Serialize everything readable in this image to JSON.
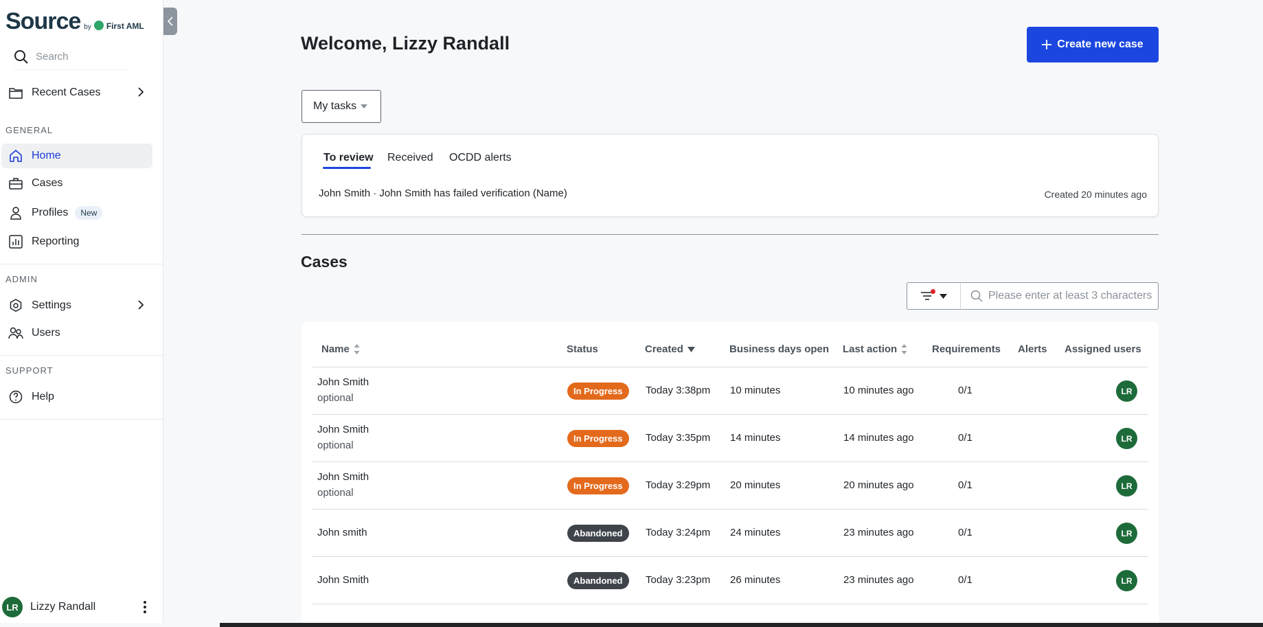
{
  "sidebar": {
    "logo": {
      "main": "Source",
      "by": "by",
      "brand": "First AML"
    },
    "search_placeholder": "Search",
    "recent_cases": "Recent Cases",
    "sections": {
      "general": "GENERAL",
      "admin": "ADMIN",
      "support": "SUPPORT"
    },
    "items": {
      "home": "Home",
      "cases": "Cases",
      "profiles": "Profiles",
      "profiles_badge": "New",
      "reporting": "Reporting",
      "settings": "Settings",
      "users": "Users",
      "help": "Help"
    },
    "user": {
      "initials": "LR",
      "name": "Lizzy Randall"
    }
  },
  "header": {
    "welcome": "Welcome, Lizzy Randall",
    "create_button": "Create new case"
  },
  "tasks": {
    "selector": "My tasks",
    "tabs": [
      "To review",
      "Received",
      "OCDD alerts"
    ],
    "active_tab": "To review",
    "item": {
      "name": "John Smith",
      "separator": "·",
      "message": "John Smith has failed verification (Name)",
      "created": "Created 20 minutes ago"
    }
  },
  "cases": {
    "title": "Cases",
    "search_placeholder": "Please enter at least 3 characters",
    "columns": [
      "Name",
      "Status",
      "Created",
      "Business days open",
      "Last action",
      "Requirements",
      "Alerts",
      "Assigned users"
    ],
    "rows": [
      {
        "name": "John Smith",
        "sub": "optional",
        "status": "In Progress",
        "status_kind": "inprog",
        "created": "Today 3:38pm",
        "days_open": "10 minutes",
        "last_action": "10 minutes ago",
        "requirements": "0/1",
        "alerts": "",
        "assigned": "LR"
      },
      {
        "name": "John Smith",
        "sub": "optional",
        "status": "In Progress",
        "status_kind": "inprog",
        "created": "Today 3:35pm",
        "days_open": "14 minutes",
        "last_action": "14 minutes ago",
        "requirements": "0/1",
        "alerts": "",
        "assigned": "LR"
      },
      {
        "name": "John Smith",
        "sub": "optional",
        "status": "In Progress",
        "status_kind": "inprog",
        "created": "Today 3:29pm",
        "days_open": "20 minutes",
        "last_action": "20 minutes ago",
        "requirements": "0/1",
        "alerts": "",
        "assigned": "LR"
      },
      {
        "name": "John smith",
        "sub": "",
        "status": "Abandoned",
        "status_kind": "aband",
        "created": "Today 3:24pm",
        "days_open": "24 minutes",
        "last_action": "23 minutes ago",
        "requirements": "0/1",
        "alerts": "",
        "assigned": "LR"
      },
      {
        "name": "John Smith",
        "sub": "",
        "status": "Abandoned",
        "status_kind": "aband",
        "created": "Today 3:23pm",
        "days_open": "26 minutes",
        "last_action": "23 minutes ago",
        "requirements": "0/1",
        "alerts": "",
        "assigned": "LR"
      }
    ]
  },
  "colors": {
    "accent": "#1b47e0",
    "in_progress": "#e36a1c",
    "abandoned": "#3f444a",
    "avatar": "#1e6b3a",
    "filter_dot": "#e0242b"
  }
}
